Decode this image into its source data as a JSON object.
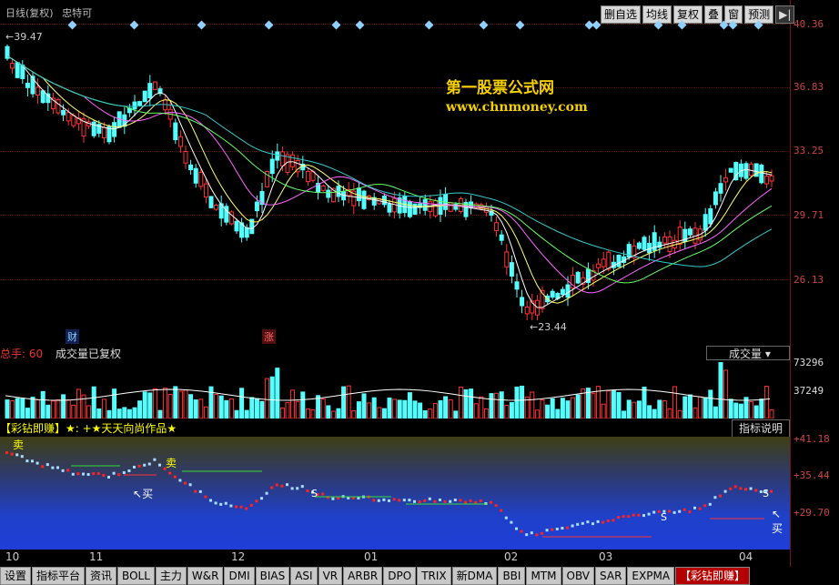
{
  "title": {
    "left": "日线(复权)",
    "stock": "忠特可"
  },
  "toolbar": [
    "删自选",
    "均线",
    "复权",
    "叠",
    "窗",
    "预测",
    "▶|"
  ],
  "main_axis": [
    "40.36",
    "36.83",
    "33.25",
    "29.71",
    "26.13"
  ],
  "annotations": {
    "high": "39.47",
    "low": "23.44",
    "cai": "财",
    "zhang": "涨"
  },
  "watermark": {
    "line1": "第一股票公式网",
    "line2": "www.chnmoney.com"
  },
  "volume": {
    "label_red": "总手: 60",
    "label": "成交量已复权",
    "select_value": "成交量",
    "axis": [
      "73296",
      "37249"
    ]
  },
  "indicator": {
    "name": "【彩钻即赚】★: +★天天向尚作品★",
    "explain": "指标说明",
    "axis": [
      "+41.18",
      "+35.44",
      "+29.70"
    ],
    "markers": {
      "sell": "卖",
      "buy": "买",
      "s": "S"
    }
  },
  "dates": [
    "10",
    "11",
    "12",
    "01",
    "02",
    "03",
    "04"
  ],
  "tabs": [
    "设置",
    "指标平台",
    "资讯",
    "BOLL",
    "主力",
    "W&R",
    "DMI",
    "BIAS",
    "ASI",
    "VR",
    "ARBR",
    "DPO",
    "TRIX",
    "新DMA",
    "BBI",
    "MTM",
    "OBV",
    "SAR",
    "EXPMA",
    "【彩钻即赚】"
  ],
  "colors": {
    "up": "#ff3333",
    "down": "#55ffff",
    "ma5": "#ffffff",
    "ma10": "#ffff66",
    "ma20": "#ff66ff",
    "ma30": "#66ff66",
    "ma60": "#33cccc"
  }
}
